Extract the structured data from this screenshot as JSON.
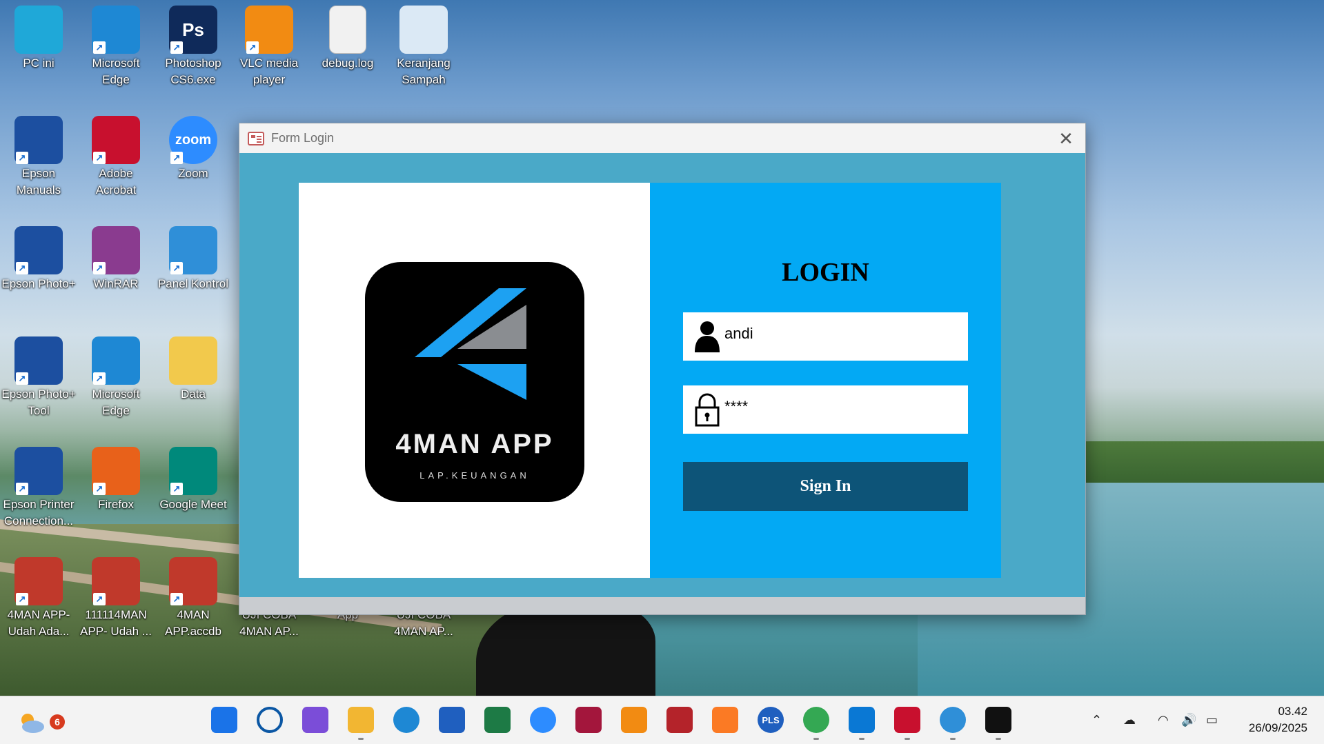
{
  "desktop": {
    "icons": [
      {
        "label": "PC ini",
        "icon": "monitor-icon",
        "color": "#1fa8d8"
      },
      {
        "label": "Microsoft Edge",
        "icon": "edge-icon",
        "color": "#1e88d4"
      },
      {
        "label": "Photoshop CS6.exe",
        "icon": "photoshop-icon",
        "color": "#0f2a5a",
        "glyph": "Ps"
      },
      {
        "label": "VLC media player",
        "icon": "vlc-cone-icon",
        "color": "#f28b12"
      },
      {
        "label": "debug.log",
        "icon": "document-icon",
        "color": "#f1f1f1"
      },
      {
        "label": "Keranjang Sampah",
        "icon": "recycle-bin-icon",
        "color": "#dbe9f5"
      },
      {
        "label": "Epson Manuals",
        "icon": "epson-manuals-icon",
        "color": "#1c4fa0"
      },
      {
        "label": "Adobe Acrobat",
        "icon": "acrobat-icon",
        "color": "#c8102e"
      },
      {
        "label": "Zoom",
        "icon": "zoom-icon",
        "color": "#2d8cff",
        "glyph": "zoom"
      },
      {
        "label": "Epson Photo+",
        "icon": "epson-photo-icon",
        "color": "#1c4fa0"
      },
      {
        "label": "WinRAR",
        "icon": "winrar-icon",
        "color": "#8a3b8f"
      },
      {
        "label": "Panel Kontrol",
        "icon": "control-panel-icon",
        "color": "#2f8fd8"
      },
      {
        "label": "Epson Photo+ Tool",
        "icon": "epson-photo-tool-icon",
        "color": "#1c4fa0"
      },
      {
        "label": "Microsoft Edge",
        "icon": "edge-icon",
        "color": "#1e88d4"
      },
      {
        "label": "Data",
        "icon": "folder-icon",
        "color": "#f2c94c"
      },
      {
        "label": "Epson Printer Connection...",
        "icon": "epson-printer-icon",
        "color": "#1c4fa0"
      },
      {
        "label": "Firefox",
        "icon": "firefox-icon",
        "color": "#e8611a"
      },
      {
        "label": "Google Meet",
        "icon": "google-meet-icon",
        "color": "#00897b"
      },
      {
        "label": "4MAN APP- Udah Ada...",
        "icon": "access-file-icon",
        "color": "#c0392b"
      },
      {
        "label": "111114MAN APP- Udah ...",
        "icon": "access-file-icon",
        "color": "#c0392b"
      },
      {
        "label": "4MAN APP.accdb",
        "icon": "access-file-icon",
        "color": "#c0392b"
      },
      {
        "label": "UJI COBA 4MAN AP...",
        "icon": "hidden-icon",
        "color": "#555555"
      },
      {
        "label": "App",
        "icon": "hidden-icon",
        "color": "#555555"
      },
      {
        "label": "UJI COBA 4MAN AP...",
        "icon": "hidden-icon",
        "color": "#555555"
      }
    ]
  },
  "window": {
    "title": "Form Login",
    "logo_text": "4MAN APP",
    "logo_subtext": "LAP.KEUANGAN",
    "login_heading": "LOGIN",
    "username_value": "andi",
    "password_value": "****",
    "signin_label": "Sign In",
    "colors": {
      "panel_blue": "#03a9f4",
      "button": "#0d5478",
      "frame": "#4aa9c8",
      "logo_blue": "#1da1f2"
    }
  },
  "taskbar": {
    "weather_badge": "6",
    "apps": [
      "windows-start-icon",
      "search-icon",
      "copilot-icon",
      "file-explorer-icon",
      "edge-icon",
      "word-icon",
      "excel-icon",
      "zoom-icon",
      "mendeley-icon",
      "vlc-icon",
      "access-icon",
      "xampp-icon",
      "pls-icon",
      "chrome-icon",
      "vscode-icon",
      "acrobat-icon",
      "sync-icon",
      "4man-app-icon"
    ],
    "pls_label": "PLS",
    "time": "03.42",
    "date": "26/09/2025"
  }
}
